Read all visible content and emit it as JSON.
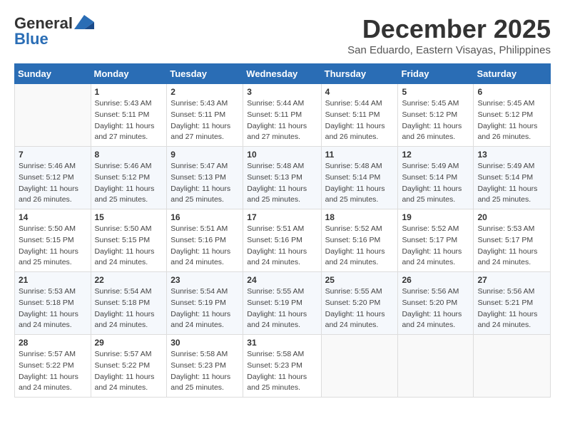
{
  "logo": {
    "part1": "General",
    "part2": "Blue"
  },
  "title": "December 2025",
  "location": "San Eduardo, Eastern Visayas, Philippines",
  "days_of_week": [
    "Sunday",
    "Monday",
    "Tuesday",
    "Wednesday",
    "Thursday",
    "Friday",
    "Saturday"
  ],
  "weeks": [
    [
      {
        "day": "",
        "info": ""
      },
      {
        "day": "1",
        "info": "Sunrise: 5:43 AM\nSunset: 5:11 PM\nDaylight: 11 hours\nand 27 minutes."
      },
      {
        "day": "2",
        "info": "Sunrise: 5:43 AM\nSunset: 5:11 PM\nDaylight: 11 hours\nand 27 minutes."
      },
      {
        "day": "3",
        "info": "Sunrise: 5:44 AM\nSunset: 5:11 PM\nDaylight: 11 hours\nand 27 minutes."
      },
      {
        "day": "4",
        "info": "Sunrise: 5:44 AM\nSunset: 5:11 PM\nDaylight: 11 hours\nand 26 minutes."
      },
      {
        "day": "5",
        "info": "Sunrise: 5:45 AM\nSunset: 5:12 PM\nDaylight: 11 hours\nand 26 minutes."
      },
      {
        "day": "6",
        "info": "Sunrise: 5:45 AM\nSunset: 5:12 PM\nDaylight: 11 hours\nand 26 minutes."
      }
    ],
    [
      {
        "day": "7",
        "info": "Sunrise: 5:46 AM\nSunset: 5:12 PM\nDaylight: 11 hours\nand 26 minutes."
      },
      {
        "day": "8",
        "info": "Sunrise: 5:46 AM\nSunset: 5:12 PM\nDaylight: 11 hours\nand 25 minutes."
      },
      {
        "day": "9",
        "info": "Sunrise: 5:47 AM\nSunset: 5:13 PM\nDaylight: 11 hours\nand 25 minutes."
      },
      {
        "day": "10",
        "info": "Sunrise: 5:48 AM\nSunset: 5:13 PM\nDaylight: 11 hours\nand 25 minutes."
      },
      {
        "day": "11",
        "info": "Sunrise: 5:48 AM\nSunset: 5:14 PM\nDaylight: 11 hours\nand 25 minutes."
      },
      {
        "day": "12",
        "info": "Sunrise: 5:49 AM\nSunset: 5:14 PM\nDaylight: 11 hours\nand 25 minutes."
      },
      {
        "day": "13",
        "info": "Sunrise: 5:49 AM\nSunset: 5:14 PM\nDaylight: 11 hours\nand 25 minutes."
      }
    ],
    [
      {
        "day": "14",
        "info": "Sunrise: 5:50 AM\nSunset: 5:15 PM\nDaylight: 11 hours\nand 25 minutes."
      },
      {
        "day": "15",
        "info": "Sunrise: 5:50 AM\nSunset: 5:15 PM\nDaylight: 11 hours\nand 24 minutes."
      },
      {
        "day": "16",
        "info": "Sunrise: 5:51 AM\nSunset: 5:16 PM\nDaylight: 11 hours\nand 24 minutes."
      },
      {
        "day": "17",
        "info": "Sunrise: 5:51 AM\nSunset: 5:16 PM\nDaylight: 11 hours\nand 24 minutes."
      },
      {
        "day": "18",
        "info": "Sunrise: 5:52 AM\nSunset: 5:16 PM\nDaylight: 11 hours\nand 24 minutes."
      },
      {
        "day": "19",
        "info": "Sunrise: 5:52 AM\nSunset: 5:17 PM\nDaylight: 11 hours\nand 24 minutes."
      },
      {
        "day": "20",
        "info": "Sunrise: 5:53 AM\nSunset: 5:17 PM\nDaylight: 11 hours\nand 24 minutes."
      }
    ],
    [
      {
        "day": "21",
        "info": "Sunrise: 5:53 AM\nSunset: 5:18 PM\nDaylight: 11 hours\nand 24 minutes."
      },
      {
        "day": "22",
        "info": "Sunrise: 5:54 AM\nSunset: 5:18 PM\nDaylight: 11 hours\nand 24 minutes."
      },
      {
        "day": "23",
        "info": "Sunrise: 5:54 AM\nSunset: 5:19 PM\nDaylight: 11 hours\nand 24 minutes."
      },
      {
        "day": "24",
        "info": "Sunrise: 5:55 AM\nSunset: 5:19 PM\nDaylight: 11 hours\nand 24 minutes."
      },
      {
        "day": "25",
        "info": "Sunrise: 5:55 AM\nSunset: 5:20 PM\nDaylight: 11 hours\nand 24 minutes."
      },
      {
        "day": "26",
        "info": "Sunrise: 5:56 AM\nSunset: 5:20 PM\nDaylight: 11 hours\nand 24 minutes."
      },
      {
        "day": "27",
        "info": "Sunrise: 5:56 AM\nSunset: 5:21 PM\nDaylight: 11 hours\nand 24 minutes."
      }
    ],
    [
      {
        "day": "28",
        "info": "Sunrise: 5:57 AM\nSunset: 5:22 PM\nDaylight: 11 hours\nand 24 minutes."
      },
      {
        "day": "29",
        "info": "Sunrise: 5:57 AM\nSunset: 5:22 PM\nDaylight: 11 hours\nand 24 minutes."
      },
      {
        "day": "30",
        "info": "Sunrise: 5:58 AM\nSunset: 5:23 PM\nDaylight: 11 hours\nand 25 minutes."
      },
      {
        "day": "31",
        "info": "Sunrise: 5:58 AM\nSunset: 5:23 PM\nDaylight: 11 hours\nand 25 minutes."
      },
      {
        "day": "",
        "info": ""
      },
      {
        "day": "",
        "info": ""
      },
      {
        "day": "",
        "info": ""
      }
    ]
  ]
}
